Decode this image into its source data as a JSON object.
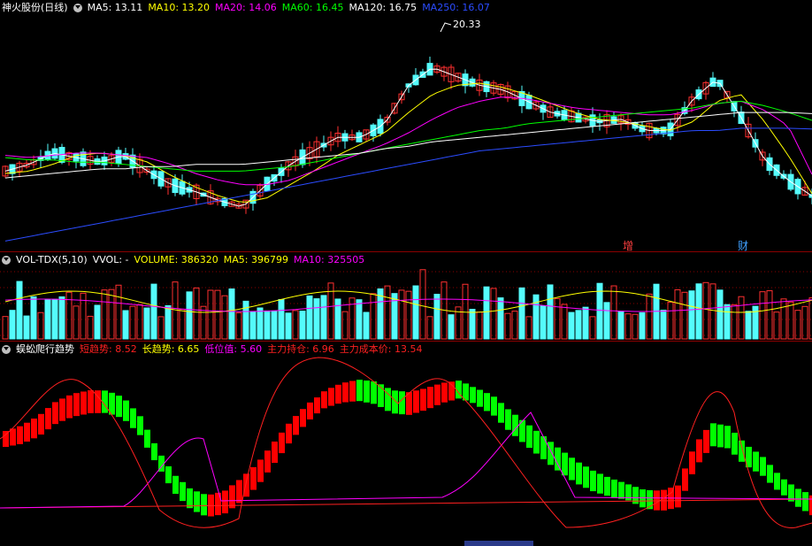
{
  "main": {
    "stock_name": "神火股份(日线)",
    "mas": [
      {
        "label": "MA5: 13.11",
        "color": "#ffffff"
      },
      {
        "label": "MA10: 13.20",
        "color": "#ffff00"
      },
      {
        "label": "MA20: 14.06",
        "color": "#ff00ff"
      },
      {
        "label": "MA60: 16.45",
        "color": "#00ff00"
      },
      {
        "label": "MA120: 16.75",
        "color": "#ffffff"
      },
      {
        "label": "MA250: 16.07",
        "color": "#2b4cff"
      }
    ],
    "high_marker": "20.33",
    "event_markers": [
      {
        "label": "增",
        "color": "#ff4040"
      },
      {
        "label": "财",
        "color": "#40a0ff"
      }
    ]
  },
  "volume": {
    "name": "VOL-TDX(5,10)",
    "vvol": "VVOL: -",
    "volume": "VOLUME: 386320",
    "ma5": "MA5: 396799",
    "ma10": "MA10: 325505"
  },
  "indicator": {
    "name": "蜈蚣爬行趋势",
    "items": [
      {
        "label": "短趋势: 8.52",
        "color": "#ff2020"
      },
      {
        "label": "长趋势: 6.65",
        "color": "#ffff00"
      },
      {
        "label": "低位值: 5.60",
        "color": "#ff00ff"
      },
      {
        "label": "主力持仓: 6.96",
        "color": "#ff2020"
      },
      {
        "label": "主力成本价: 13.54",
        "color": "#ff2020"
      }
    ]
  },
  "colors": {
    "up": "#ff3030",
    "down": "#54fcfc",
    "bar_up": "#ff0000",
    "bar_down": "#00ff00",
    "grid_dash": "#8b0000"
  },
  "chart_data": [
    {
      "type": "candlestick",
      "title": "神火股份(日线)",
      "ylim": [
        11,
        21
      ],
      "annotations": [
        "20.33"
      ],
      "series": [
        {
          "name": "MA5",
          "values": [
            14.2,
            14.5,
            15.0,
            14.8,
            14.6,
            14.9,
            14.2,
            13.6,
            13.3,
            12.9,
            12.6,
            13.6,
            14.5,
            15.1,
            15.7,
            15.7,
            16.3,
            18.0,
            18.8,
            18.4,
            18.0,
            17.8,
            17.3,
            16.8,
            16.6,
            16.4,
            16.5,
            16.0,
            16.0,
            17.4,
            18.3,
            16.6,
            14.7,
            13.8,
            13.1
          ]
        },
        {
          "name": "MA10",
          "values": [
            14.1,
            14.2,
            14.5,
            14.9,
            15.0,
            14.9,
            14.6,
            14.0,
            13.5,
            13.1,
            12.8,
            13.0,
            13.6,
            14.2,
            14.9,
            15.4,
            15.9,
            16.8,
            17.6,
            18.0,
            18.1,
            17.9,
            17.6,
            17.2,
            16.8,
            16.5,
            16.4,
            16.2,
            16.0,
            16.4,
            17.3,
            17.6,
            16.4,
            14.9,
            13.2
          ]
        },
        {
          "name": "MA20",
          "values": [
            14.9,
            14.8,
            14.9,
            15.0,
            15.0,
            14.9,
            14.8,
            14.5,
            14.1,
            13.8,
            13.6,
            13.6,
            13.8,
            14.2,
            14.6,
            15.0,
            15.4,
            15.9,
            16.5,
            17.0,
            17.3,
            17.5,
            17.4,
            17.2,
            17.0,
            16.9,
            16.8,
            16.7,
            16.7,
            16.9,
            17.2,
            17.3,
            16.9,
            16.2,
            14.06
          ]
        },
        {
          "name": "MA60",
          "values": [
            14.8,
            14.7,
            14.7,
            14.6,
            14.6,
            14.5,
            14.4,
            14.3,
            14.2,
            14.2,
            14.2,
            14.3,
            14.4,
            14.6,
            14.8,
            15.0,
            15.2,
            15.4,
            15.6,
            15.8,
            16.0,
            16.1,
            16.3,
            16.4,
            16.5,
            16.6,
            16.7,
            16.8,
            16.9,
            17.0,
            17.2,
            17.3,
            17.1,
            16.8,
            16.45
          ]
        },
        {
          "name": "MA120",
          "values": [
            13.9,
            14.0,
            14.1,
            14.2,
            14.3,
            14.3,
            14.4,
            14.4,
            14.5,
            14.5,
            14.5,
            14.6,
            14.7,
            14.8,
            14.9,
            15.0,
            15.2,
            15.3,
            15.5,
            15.6,
            15.7,
            15.8,
            15.9,
            16.0,
            16.1,
            16.2,
            16.3,
            16.4,
            16.5,
            16.6,
            16.7,
            16.8,
            16.8,
            16.8,
            16.75
          ]
        },
        {
          "name": "MA250",
          "values": [
            11.1,
            11.3,
            11.5,
            11.7,
            11.9,
            12.1,
            12.3,
            12.5,
            12.7,
            12.9,
            13.1,
            13.3,
            13.5,
            13.7,
            13.9,
            14.1,
            14.3,
            14.5,
            14.7,
            14.9,
            15.1,
            15.2,
            15.3,
            15.4,
            15.5,
            15.6,
            15.7,
            15.8,
            15.9,
            16.0,
            16.0,
            16.1,
            16.1,
            16.1,
            16.07
          ]
        }
      ]
    },
    {
      "type": "bar",
      "title": "VOL-TDX(5,10)",
      "series": [
        {
          "name": "VOLUME",
          "values": [
            386320
          ]
        },
        {
          "name": "MA5",
          "values": [
            396799
          ]
        },
        {
          "name": "MA10",
          "values": [
            325505
          ]
        }
      ]
    },
    {
      "type": "bar",
      "title": "蜈蚣爬行趋势",
      "series": [
        {
          "name": "短趋势",
          "values": [
            8.52
          ]
        },
        {
          "name": "长趋势",
          "values": [
            6.65
          ]
        },
        {
          "name": "低位值",
          "values": [
            5.6
          ]
        },
        {
          "name": "主力持仓",
          "values": [
            6.96
          ]
        },
        {
          "name": "主力成本价",
          "values": [
            13.54
          ]
        }
      ]
    }
  ]
}
